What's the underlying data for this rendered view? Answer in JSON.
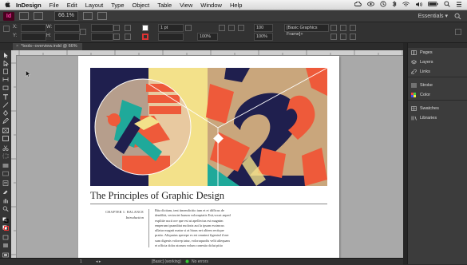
{
  "menubar": {
    "app": "InDesign",
    "items": [
      "File",
      "Edit",
      "Layout",
      "Type",
      "Object",
      "Table",
      "View",
      "Window",
      "Help"
    ]
  },
  "appbar": {
    "logo": "Id",
    "zoom": "66.1%",
    "workspace": "Essentials ▾"
  },
  "control": {
    "x_label": "X:",
    "y_label": "Y:",
    "w_label": "W:",
    "h_label": "H:",
    "stroke_weight": "1 pt",
    "opacity": "100%",
    "size_value": "100%",
    "frame_value": "100",
    "object_style": "[Basic Graphics Frame]+"
  },
  "document": {
    "tab_label": "*tools--overview.indd @ 66%"
  },
  "page": {
    "title": "The Principles of Graphic Design",
    "chapter_label": "CHAPTER 1: BALANCE",
    "intro_label": "Introduction",
    "body_lines": [
      "Bita dicitam, tent timendicitio ium et et difficus de",
      "dendibit, vecinciet harum voloruptatis Esit,vocat aeped",
      "explitie uscit ore que est ut apellecius est magnim",
      "emperum ipsanditat moloria aut la ipsam essimcus",
      "ullatur magnit matur si at hiaus net alitem rectique",
      "pratio. Aliquatus sperepe es est omnimi figenisd il ner",
      "sum digenis volorep tatur, voloraquodis velit aliequam",
      "et officia dolor atorum volum conestio dolut pitio"
    ]
  },
  "status": {
    "page": "1",
    "profile": "[Basic] (working)",
    "errors": "No errors"
  },
  "panels": {
    "items": [
      {
        "label": "Pages",
        "icon": "pages-icon"
      },
      {
        "label": "Layers",
        "icon": "layers-icon"
      },
      {
        "label": "Links",
        "icon": "links-icon"
      },
      {
        "label": "Stroke",
        "icon": "stroke-icon"
      },
      {
        "label": "Color",
        "icon": "color-icon"
      },
      {
        "label": "Swatches",
        "icon": "swatches-icon"
      },
      {
        "label": "Libraries",
        "icon": "libraries-icon"
      }
    ]
  },
  "colors": {
    "navy": "#1f1f4e",
    "yellow": "#f3e18a",
    "orange": "#ee5a3a",
    "teal": "#1fa99a",
    "tan": "#c9a67c"
  }
}
